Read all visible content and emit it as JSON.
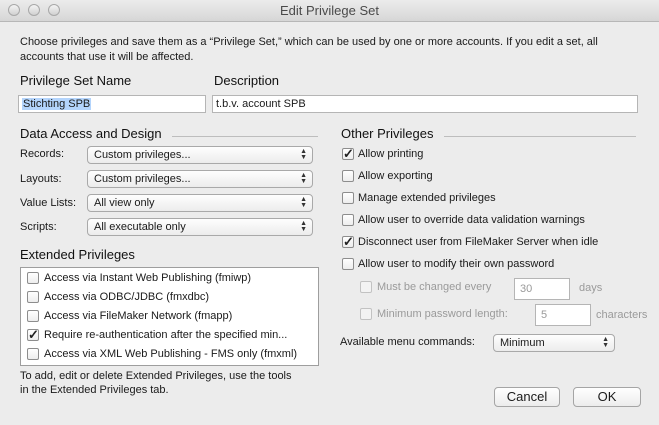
{
  "window": {
    "title": "Edit Privilege Set"
  },
  "intro": "Choose privileges and save them as a “Privilege Set,” which can be used by one or more accounts. If you edit a set, all accounts that use it will be affected.",
  "name_field": {
    "label": "Privilege Set Name",
    "value": "Stichting SPB"
  },
  "description_field": {
    "label": "Description",
    "value": "t.b.v. account SPB"
  },
  "data_access": {
    "heading": "Data Access and Design",
    "rows": [
      {
        "label": "Records:",
        "value": "Custom privileges..."
      },
      {
        "label": "Layouts:",
        "value": "Custom privileges..."
      },
      {
        "label": "Value Lists:",
        "value": "All view only"
      },
      {
        "label": "Scripts:",
        "value": "All executable only"
      }
    ]
  },
  "extended": {
    "heading": "Extended Privileges",
    "items": [
      {
        "label": "Access via Instant Web Publishing (fmiwp)",
        "checked": false
      },
      {
        "label": "Access via ODBC/JDBC (fmxdbc)",
        "checked": false
      },
      {
        "label": "Access via FileMaker Network (fmapp)",
        "checked": false
      },
      {
        "label": "Require re-authentication after the specified min...",
        "checked": true
      },
      {
        "label": "Access via XML Web Publishing - FMS only (fmxml)",
        "checked": false
      }
    ],
    "footer": "To add, edit or delete Extended Privileges, use the tools in the Extended Privileges tab."
  },
  "other": {
    "heading": "Other Privileges",
    "items": [
      {
        "label": "Allow printing",
        "checked": true
      },
      {
        "label": "Allow exporting",
        "checked": false
      },
      {
        "label": "Manage extended privileges",
        "checked": false
      },
      {
        "label": "Allow user to override data validation warnings",
        "checked": false
      },
      {
        "label": "Disconnect user from FileMaker Server when idle",
        "checked": true
      },
      {
        "label": "Allow user to modify their own password",
        "checked": false
      }
    ],
    "must_change": {
      "label": "Must be changed every",
      "value": "30",
      "unit": "days"
    },
    "min_length": {
      "label": "Minimum password length:",
      "value": "5",
      "unit": "characters"
    },
    "menu_commands": {
      "label": "Available menu commands:",
      "value": "Minimum"
    }
  },
  "buttons": {
    "cancel": "Cancel",
    "ok": "OK"
  }
}
